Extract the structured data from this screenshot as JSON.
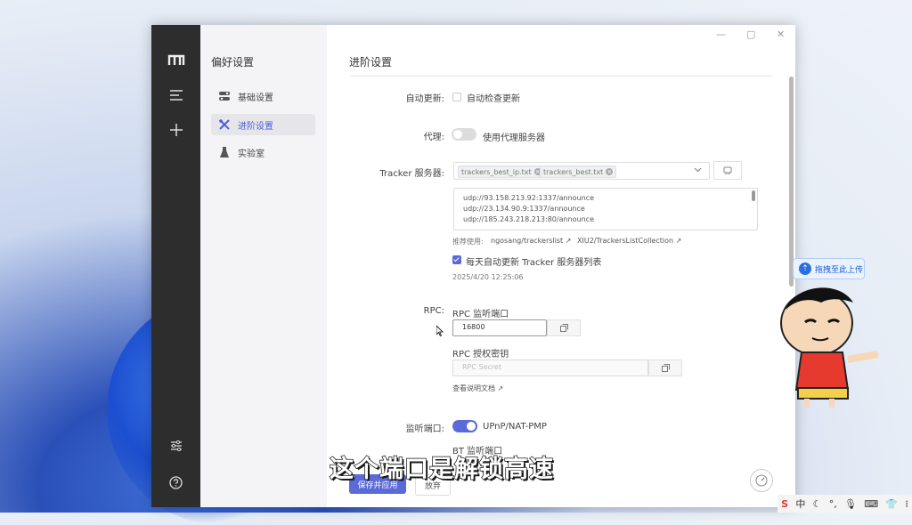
{
  "nav": {
    "title": "偏好设置",
    "items": [
      {
        "label": "基础设置",
        "icon": "toggle-icon"
      },
      {
        "label": "进阶设置",
        "icon": "tools-icon"
      },
      {
        "label": "实验室",
        "icon": "flask-icon"
      }
    ]
  },
  "page": {
    "title": "进阶设置"
  },
  "auto_update": {
    "label": "自动更新:",
    "checkbox_label": "自动检查更新",
    "checked": false
  },
  "proxy": {
    "label": "代理:",
    "toggle_label": "使用代理服务器",
    "enabled": false
  },
  "tracker": {
    "label": "Tracker 服务器:",
    "tags": [
      "trackers_best_ip.txt",
      "trackers_best.txt"
    ],
    "list": [
      "udp://93.158.213.92:1337/announce",
      "udp://23.134.90.9:1337/announce",
      "udp://185.243.218.213:80/announce"
    ],
    "recommend_label": "推荐使用:",
    "recommend_links": [
      "ngosang/trackerslist",
      "XIU2/TrackersListCollection"
    ],
    "daily_update_label": "每天自动更新 Tracker 服务器列表",
    "daily_update_checked": true,
    "updated_time": "2025/4/20 12:25:06"
  },
  "rpc": {
    "label": "RPC:",
    "port_label": "RPC 监听端口",
    "port_value": "16800",
    "secret_label": "RPC 授权密钥",
    "secret_placeholder": "RPC Secret",
    "docs_link": "查看说明文档"
  },
  "listen": {
    "label": "监听端口:",
    "upnp_label": "UPnP/NAT-PMP",
    "upnp_enabled": true,
    "bt_port_label": "BT 监听端口"
  },
  "actions": {
    "save_label": "保存并应用",
    "discard_label": "放弃"
  },
  "overlay": {
    "subtitle": "这个端口是解锁高速",
    "upload_label": "拖拽至此上传",
    "tray_ime": "中"
  },
  "colors": {
    "accent": "#5a6ad8",
    "rail": "#2d2d2d"
  }
}
